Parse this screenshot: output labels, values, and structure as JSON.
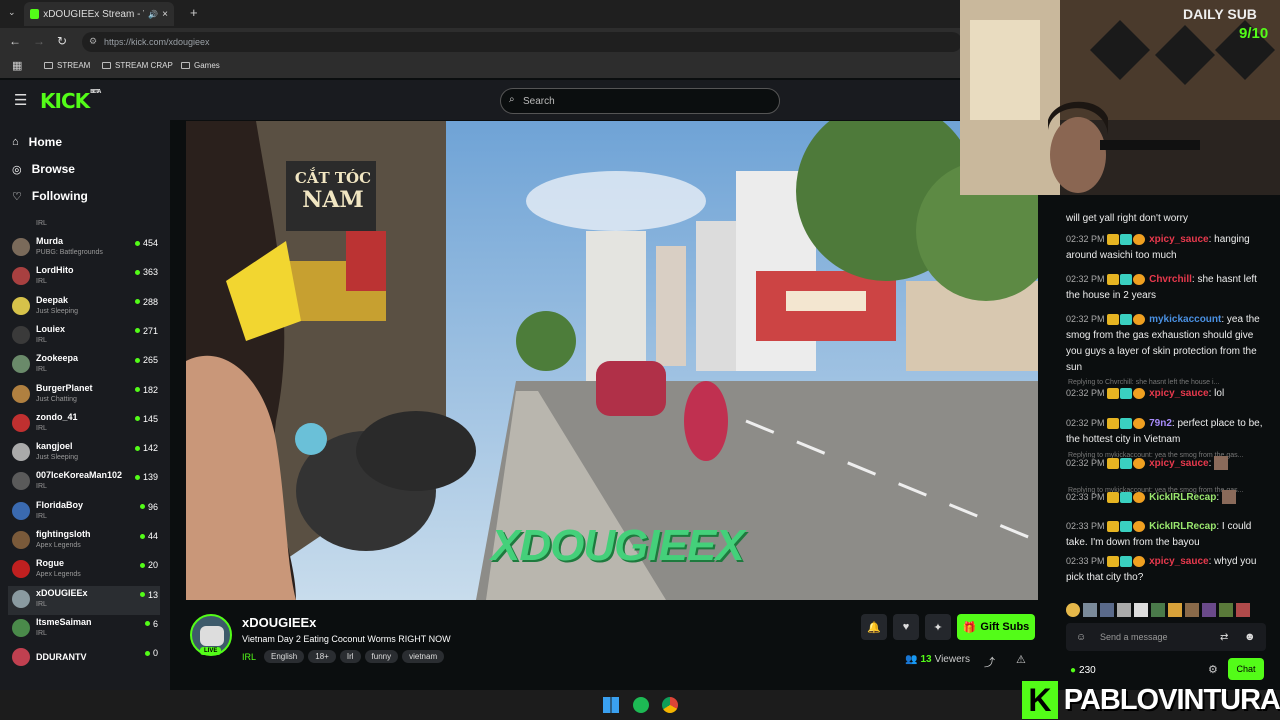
{
  "browser": {
    "tab_title": "xDOUGIEEx Stream - Watch",
    "url": "https://kick.com/xdougieex",
    "bookmarks": [
      "STREAM",
      "STREAM CRAP",
      "Games"
    ]
  },
  "kick": {
    "logo": "KICK",
    "logo_beta": "BETA",
    "search_placeholder": "Search"
  },
  "sidebar": {
    "nav": [
      {
        "label": "Home",
        "icon": "home-icon"
      },
      {
        "label": "Browse",
        "icon": "compass-icon"
      },
      {
        "label": "Following",
        "icon": "heart-icon"
      }
    ],
    "partial_top_category": "IRL",
    "channels": [
      {
        "name": "Murda",
        "category": "PUBG: Battlegrounds",
        "viewers": "454",
        "color": "#7a6a5a"
      },
      {
        "name": "LordHito",
        "category": "IRL",
        "viewers": "363",
        "color": "#a84040"
      },
      {
        "name": "Deepak",
        "category": "Just Sleeping",
        "viewers": "288",
        "color": "#d6c24a"
      },
      {
        "name": "Louiex",
        "category": "IRL",
        "viewers": "271",
        "color": "#3a3a3a"
      },
      {
        "name": "Zookeepa",
        "category": "IRL",
        "viewers": "265",
        "color": "#6a8a6a"
      },
      {
        "name": "BurgerPlanet",
        "category": "Just Chatting",
        "viewers": "182",
        "color": "#b08040"
      },
      {
        "name": "zondo_41",
        "category": "IRL",
        "viewers": "145",
        "color": "#c03030"
      },
      {
        "name": "kangjoel",
        "category": "Just Sleeping",
        "viewers": "142",
        "color": "#aaaaaa"
      },
      {
        "name": "007IceKoreaMan102",
        "category": "IRL",
        "viewers": "139",
        "color": "#5a5a5a"
      },
      {
        "name": "FloridaBoy",
        "category": "IRL",
        "viewers": "96",
        "color": "#3a6ab0"
      },
      {
        "name": "fightingsloth",
        "category": "Apex Legends",
        "viewers": "44",
        "color": "#7a5a3a"
      },
      {
        "name": "Rogue",
        "category": "Apex Legends",
        "viewers": "20",
        "color": "#c02020"
      },
      {
        "name": "xDOUGIEEx",
        "category": "IRL",
        "viewers": "13",
        "color": "#8a9aa0"
      },
      {
        "name": "ItsmeSaiman",
        "category": "IRL",
        "viewers": "6",
        "color": "#4a8a4a"
      },
      {
        "name": "DDURANTV",
        "category": "",
        "viewers": "0",
        "color": "#c04050"
      }
    ]
  },
  "video": {
    "watermark": "XDOUGIEEX",
    "sign_text_1": "CẮT TÓC",
    "sign_text_2": "NAM"
  },
  "stream": {
    "channel_name": "xDOUGIEEx",
    "live_label": "LIVE",
    "title": "Vietnam Day 2 Eating Coconut Worms RIGHT NOW",
    "category": "IRL",
    "tags": [
      "English",
      "18+",
      "Irl",
      "funny",
      "vietnam"
    ],
    "gift_label": "Gift Subs",
    "viewers_count": "13",
    "viewers_label": "Viewers"
  },
  "chat": {
    "partial_top": "will get yall right don't worry",
    "messages": [
      {
        "time": "02:32 PM",
        "user": "xpicy_sauce",
        "user_color": "#e8394d",
        "text": "hanging around wasichi too much",
        "reply": ""
      },
      {
        "time": "02:32 PM",
        "user": "Chvrchill",
        "user_color": "#e8394d",
        "text": "she hasnt left the house in 2 years",
        "reply": ""
      },
      {
        "time": "02:32 PM",
        "user": "mykickaccount",
        "user_color": "#4a90e2",
        "text": "yea the smog from the gas exhaustion should give you guys a layer of skin protection from the sun",
        "reply": ""
      },
      {
        "time": "02:32 PM",
        "user": "xpicy_sauce",
        "user_color": "#e8394d",
        "text": "lol",
        "reply": "Replying to Chvrchill: she hasnt left the house i..."
      },
      {
        "time": "02:32 PM",
        "user": "79n2",
        "user_color": "#a78bfa",
        "text": "perfect place to be, the hottest city in Vietnam",
        "reply": ""
      },
      {
        "time": "02:32 PM",
        "user": "xpicy_sauce",
        "user_color": "#e8394d",
        "text": "",
        "reply": "Replying to mykickaccount: yea the smog from the gas..."
      },
      {
        "time": "02:33 PM",
        "user": "KickIRLRecap",
        "user_color": "#9ae66e",
        "text": "",
        "reply": "Replying to mykickaccount: yea the smog from the gas..."
      },
      {
        "time": "02:33 PM",
        "user": "KickIRLRecap",
        "user_color": "#9ae66e",
        "text": "I could take. I'm down from the bayou",
        "reply": ""
      },
      {
        "time": "02:33 PM",
        "user": "xpicy_sauce",
        "user_color": "#e8394d",
        "text": "whyd you pick that city tho?",
        "reply": ""
      }
    ],
    "input_placeholder": "Send a message",
    "points": "230",
    "chat_button": "Chat"
  },
  "overlay": {
    "daily_sub_label": "DAILY SUB",
    "daily_sub_count": "9/10",
    "brand": "PABLOVINTURA",
    "brand_letter": "K"
  },
  "colors": {
    "accent": "#53fc18",
    "bg": "#0b0e0f",
    "panel": "#191b1f"
  }
}
